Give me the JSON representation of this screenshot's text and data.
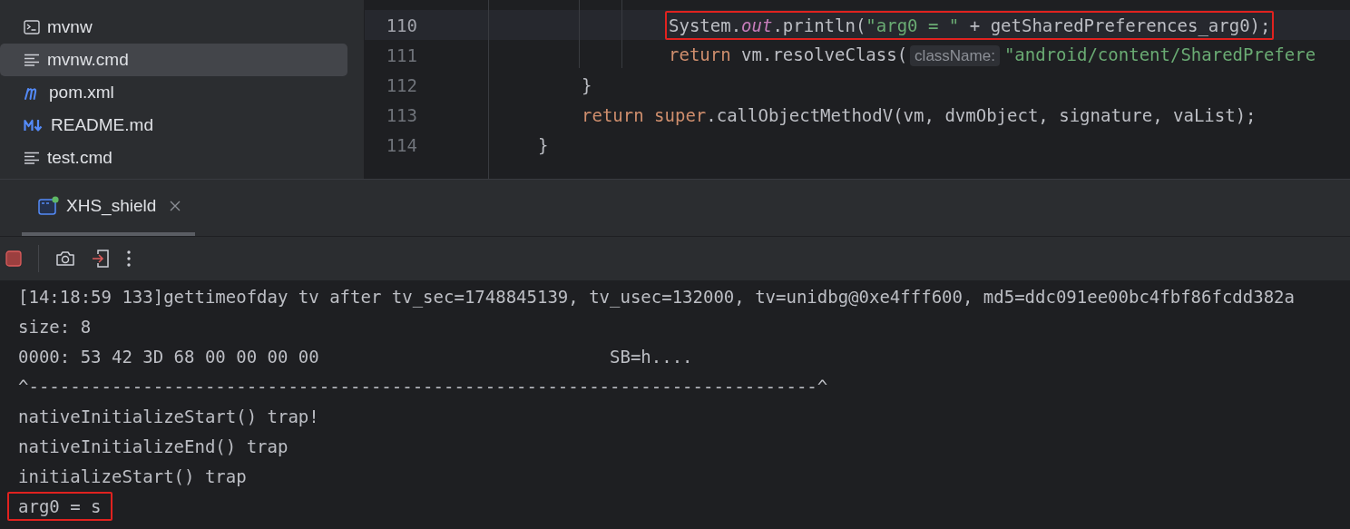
{
  "project_tree": {
    "items": [
      {
        "kind": "terminal",
        "name": "mvnw",
        "selected": false
      },
      {
        "kind": "text",
        "name": "mvnw.cmd",
        "selected": true
      },
      {
        "kind": "maven",
        "name": "pom.xml",
        "selected": false
      },
      {
        "kind": "markdown",
        "name": "README.md",
        "selected": false
      },
      {
        "kind": "text",
        "name": "test.cmd",
        "selected": false
      }
    ]
  },
  "editor": {
    "lines": [
      {
        "number": "110",
        "current": true,
        "highlighted": true,
        "kind": "nested",
        "tokens": [
          {
            "kind": "plain",
            "text": "System."
          },
          {
            "kind": "static",
            "text": "out"
          },
          {
            "kind": "plain",
            "text": ".println("
          },
          {
            "kind": "string",
            "text": "\"arg0 = \""
          },
          {
            "kind": "plain",
            "text": " + getSharedPreferences_arg0);"
          }
        ]
      },
      {
        "number": "111",
        "current": false,
        "highlighted": false,
        "kind": "nested",
        "tokens": [
          {
            "kind": "keyword",
            "text": "return"
          },
          {
            "kind": "plain",
            "text": " vm.resolveClass("
          },
          {
            "kind": "hint",
            "text": "className:"
          },
          {
            "kind": "string",
            "text": "\"android/content/SharedPrefere"
          }
        ]
      },
      {
        "number": "112",
        "current": false,
        "highlighted": false,
        "kind": "method",
        "tokens": [
          {
            "kind": "plain",
            "text": "}"
          }
        ]
      },
      {
        "number": "113",
        "current": false,
        "highlighted": false,
        "kind": "method",
        "tokens": [
          {
            "kind": "keyword",
            "text": "return super"
          },
          {
            "kind": "plain",
            "text": ".callObjectMethodV(vm, dvmObject, signature, vaList);"
          }
        ]
      },
      {
        "number": "114",
        "current": false,
        "highlighted": false,
        "kind": "class",
        "tokens": [
          {
            "kind": "plain",
            "text": "}"
          }
        ]
      }
    ]
  },
  "run_panel": {
    "tabs": [
      {
        "label": "XHS_shield",
        "selected": true,
        "running": true
      }
    ],
    "console": [
      {
        "text": "[14:18:59 133]gettimeofday tv after tv_sec=1748845139, tv_usec=132000, tv=unidbg@0xe4fff600, md5=ddc091ee00bc4fbf86fcdd382a",
        "highlighted": false
      },
      {
        "text": "size: 8",
        "highlighted": false
      },
      {
        "text": "0000: 53 42 3D 68 00 00 00 00                            SB=h....",
        "highlighted": false
      },
      {
        "text": "^----------------------------------------------------------------------------^",
        "highlighted": false
      },
      {
        "text": "nativeInitializeStart() trap!",
        "highlighted": false
      },
      {
        "text": "nativeInitializeEnd() trap",
        "highlighted": false
      },
      {
        "text": "initializeStart() trap",
        "highlighted": false
      },
      {
        "text": "arg0 = s",
        "highlighted": true
      }
    ]
  }
}
